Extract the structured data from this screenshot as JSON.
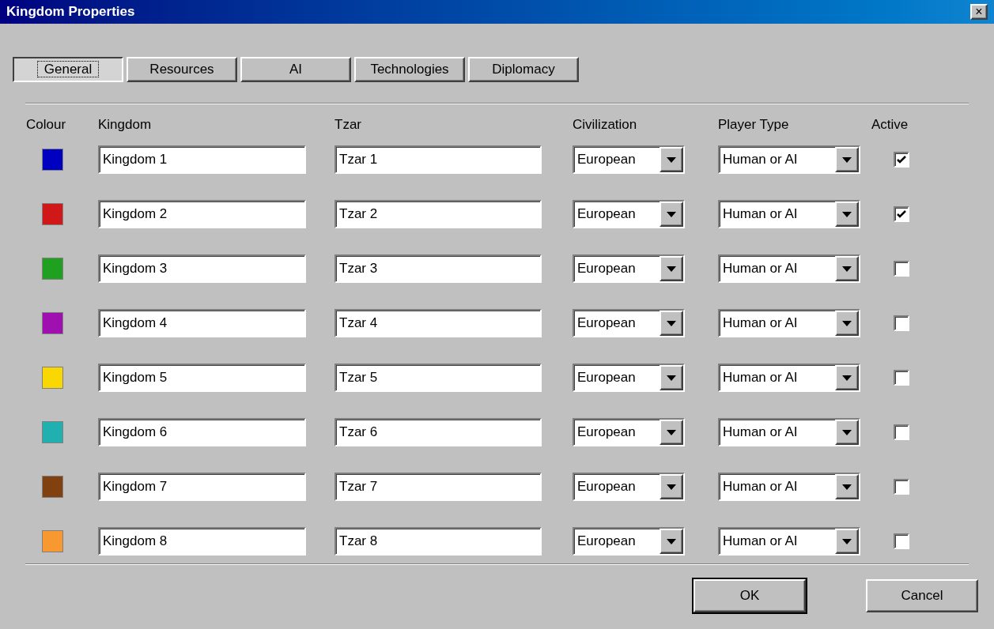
{
  "window": {
    "title": "Kingdom Properties",
    "close": "×"
  },
  "tabs": [
    {
      "label": "General",
      "selected": true
    },
    {
      "label": "Resources",
      "selected": false
    },
    {
      "label": "AI",
      "selected": false
    },
    {
      "label": "Technologies",
      "selected": false
    },
    {
      "label": "Diplomacy",
      "selected": false
    }
  ],
  "columns": [
    "Colour",
    "Kingdom",
    "Tzar",
    "Civilization",
    "Player Type",
    "Active"
  ],
  "rows": [
    {
      "color": "#0000c0",
      "kingdom": "Kingdom 1",
      "tzar": "Tzar 1",
      "civilization": "European",
      "player_type": "Human or AI",
      "active": true
    },
    {
      "color": "#d01818",
      "kingdom": "Kingdom 2",
      "tzar": "Tzar 2",
      "civilization": "European",
      "player_type": "Human or AI",
      "active": true
    },
    {
      "color": "#20a020",
      "kingdom": "Kingdom 3",
      "tzar": "Tzar 3",
      "civilization": "European",
      "player_type": "Human or AI",
      "active": false
    },
    {
      "color": "#a010b0",
      "kingdom": "Kingdom 4",
      "tzar": "Tzar 4",
      "civilization": "European",
      "player_type": "Human or AI",
      "active": false
    },
    {
      "color": "#f8d800",
      "kingdom": "Kingdom 5",
      "tzar": "Tzar 5",
      "civilization": "European",
      "player_type": "Human or AI",
      "active": false
    },
    {
      "color": "#20b0b0",
      "kingdom": "Kingdom 6",
      "tzar": "Tzar 6",
      "civilization": "European",
      "player_type": "Human or AI",
      "active": false
    },
    {
      "color": "#804010",
      "kingdom": "Kingdom 7",
      "tzar": "Tzar 7",
      "civilization": "European",
      "player_type": "Human or AI",
      "active": false
    },
    {
      "color": "#f89830",
      "kingdom": "Kingdom 8",
      "tzar": "Tzar 8",
      "civilization": "European",
      "player_type": "Human or AI",
      "active": false
    }
  ],
  "buttons": [
    {
      "label": "OK",
      "default": true
    },
    {
      "label": "Cancel",
      "default": false
    }
  ]
}
